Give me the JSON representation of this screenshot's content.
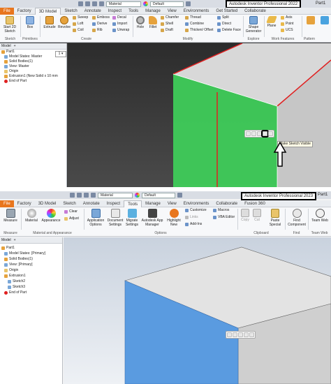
{
  "top": {
    "title": "Autodesk Inventor Professional 2022",
    "doc_name": "Part1",
    "qat_material": "Material",
    "qat_appearance": "Default",
    "menu": [
      "File",
      "Factory",
      "3D Model",
      "Sketch",
      "Annotate",
      "Inspect",
      "Tools",
      "Manage",
      "View",
      "Environments",
      "Get Started",
      "Collaborate"
    ],
    "active_tab": "3D Model",
    "ribbon": {
      "start_sketch": "Start 2D Sketch",
      "extrude": "Extrude",
      "revolve": "Revolve",
      "box": "Box",
      "sweep": "Sweep",
      "loft": "Loft",
      "coil": "Coil",
      "emboss": "Emboss",
      "derive": "Derive",
      "rib": "Rib",
      "decal": "Decal",
      "import": "Import",
      "unwrap": "Unwrap",
      "hole": "Hole",
      "fillet": "Fillet",
      "chamfer": "Chamfer",
      "shell": "Shell",
      "draft": "Draft",
      "thread": "Thread",
      "combine": "Combine",
      "thicken": "Thicken/ Offset",
      "split": "Split",
      "direct": "Direct",
      "delete_face": "Delete Face",
      "shape_generator": "Shape Generator",
      "plane": "Plane",
      "axis": "Axis",
      "point": "Point",
      "ucs": "UCS",
      "pattern": "Pattern",
      "groups": [
        "Sketch",
        "Primitives",
        "Create",
        "Modify",
        "Explore",
        "Work Features",
        "Pattern"
      ]
    },
    "browser": {
      "tab": "Model",
      "items": [
        "Part1",
        "Model States: Master",
        "Solid Bodies(1)",
        "View: Master",
        "Origin",
        "Extrusion1 (New Solid x 10 mm",
        "End of Part"
      ]
    },
    "tooltip": "Make Sketch Visible"
  },
  "bottom": {
    "title": "Autodesk Inventor Professional 2023",
    "doc_name": "Part1",
    "qat_material": "Material",
    "qat_appearance": "Default",
    "menu": [
      "File",
      "Factory",
      "3D Model",
      "Sketch",
      "Annotate",
      "Inspect",
      "Tools",
      "Manage",
      "View",
      "Environments",
      "Collaborate",
      "Fusion 360"
    ],
    "active_tab": "Tools",
    "ribbon": {
      "measure": "Measure",
      "material": "Material",
      "appearance": "Appearance",
      "clear": "Clear",
      "adjust": "Adjust",
      "app_options": "Application Options",
      "doc_settings": "Document Settings",
      "migrate_settings": "Migrate Settings",
      "app_manager": "Autodesk App Manager",
      "highlight_new": "Highlight New",
      "customize": "Customize",
      "links": "Links",
      "add_ins": "Add-Ins",
      "macros": "Macros",
      "vba_editor": "VBA Editor",
      "copy": "Copy",
      "cut": "Cut",
      "paste_special": "Paste Special",
      "find_component": "Find Component",
      "team_web": "Team Web",
      "groups": [
        "Measure",
        "Material and Appearance",
        "Options",
        "Clipboard",
        "Find",
        "Team Web"
      ]
    },
    "browser": {
      "tab": "Model",
      "items": [
        "Part1",
        "Model States: [Primary]",
        "Solid Bodies(1)",
        "View: [Primary]",
        "Origin",
        "Extrusion1",
        "Sketch2",
        "Sketch3",
        "End of Part"
      ]
    }
  },
  "colors": {
    "file_tab": "#e8761e",
    "highlight_green": "#3fd05a",
    "edge_red": "#e02020",
    "face_blue": "#5a9be0"
  }
}
